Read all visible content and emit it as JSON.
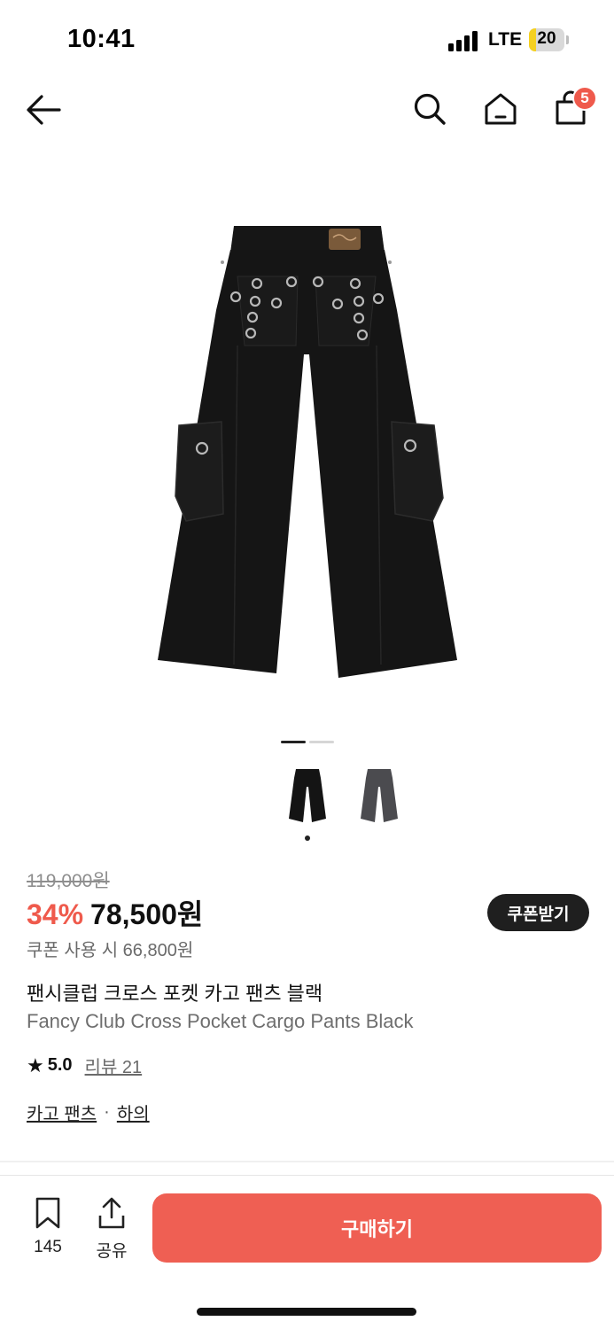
{
  "status": {
    "time": "10:41",
    "network": "LTE",
    "battery": "20",
    "battery_level": 0.2
  },
  "header": {
    "cart_count": "5"
  },
  "gallery": {
    "thumbnails": [
      "black",
      "gray"
    ],
    "active_index": 0
  },
  "product": {
    "original_price": "119,000원",
    "discount": "34%",
    "sale_price": "78,500원",
    "coupon_label": "쿠폰받기",
    "coupon_price": "쿠폰 사용 시 66,800원",
    "title_ko": "팬시클럽 크로스 포켓 카고 팬츠 블랙",
    "title_en": "Fancy Club Cross Pocket Cargo Pants Black",
    "rating": "5.0",
    "review_label": "리뷰 21",
    "categories": [
      "카고 팬츠",
      "하의"
    ]
  },
  "bottom": {
    "bookmark_count": "145",
    "share_label": "공유",
    "buy_label": "구매하기"
  },
  "colors": {
    "accent": "#ef5f53",
    "badge": "#ef5a4c",
    "battery": "#f5d020"
  }
}
